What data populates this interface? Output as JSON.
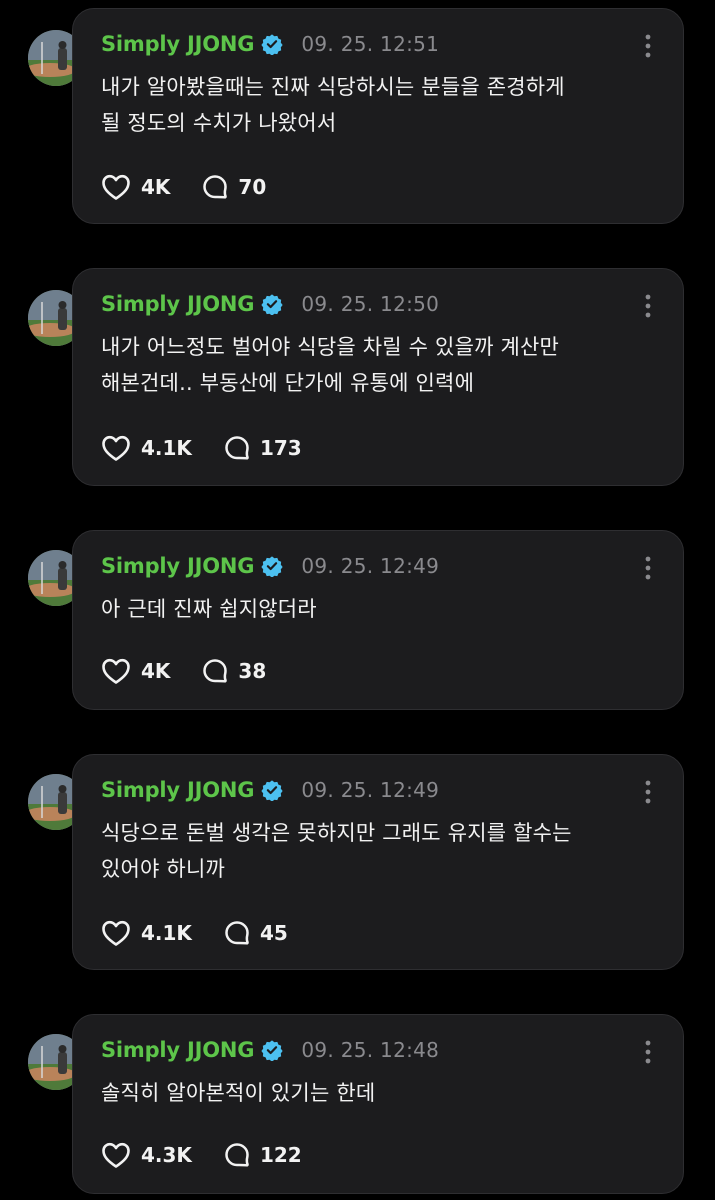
{
  "posts": [
    {
      "author": "Simply JJONG",
      "timestamp": "09. 25. 12:51",
      "lines": [
        "내가 알아봤을때는 진짜 식당하시는 분들을 존경하게",
        "될 정도의 수치가 나왔어서"
      ],
      "likes": "4K",
      "replies": "70"
    },
    {
      "author": "Simply JJONG",
      "timestamp": "09. 25. 12:50",
      "lines": [
        "내가 어느정도 벌어야 식당을 차릴 수 있을까 계산만",
        "해본건데.. 부동산에 단가에 유통에 인력에"
      ],
      "likes": "4.1K",
      "replies": "173"
    },
    {
      "author": "Simply JJONG",
      "timestamp": "09. 25. 12:49",
      "lines": [
        "아 근데 진짜 쉽지않더라"
      ],
      "likes": "4K",
      "replies": "38"
    },
    {
      "author": "Simply JJONG",
      "timestamp": "09. 25. 12:49",
      "lines": [
        "식당으로 돈벌 생각은 못하지만 그래도 유지를 할수는",
        "있어야 하니까"
      ],
      "likes": "4.1K",
      "replies": "45"
    },
    {
      "author": "Simply JJONG",
      "timestamp": "09. 25. 12:48",
      "lines": [
        "솔직히 알아본적이 있기는 한데"
      ],
      "likes": "4.3K",
      "replies": "122"
    }
  ],
  "icons": {
    "verified": "verified-badge-icon",
    "more": "more-vertical-icon",
    "like": "heart-icon",
    "reply": "speech-bubble-icon"
  },
  "colors": {
    "background": "#000000",
    "card": "#1c1c1e",
    "author_name": "#5dc54a",
    "verified_badge": "#4cc0f0",
    "timestamp": "#8a8a8e",
    "text": "#f2f2f2"
  }
}
